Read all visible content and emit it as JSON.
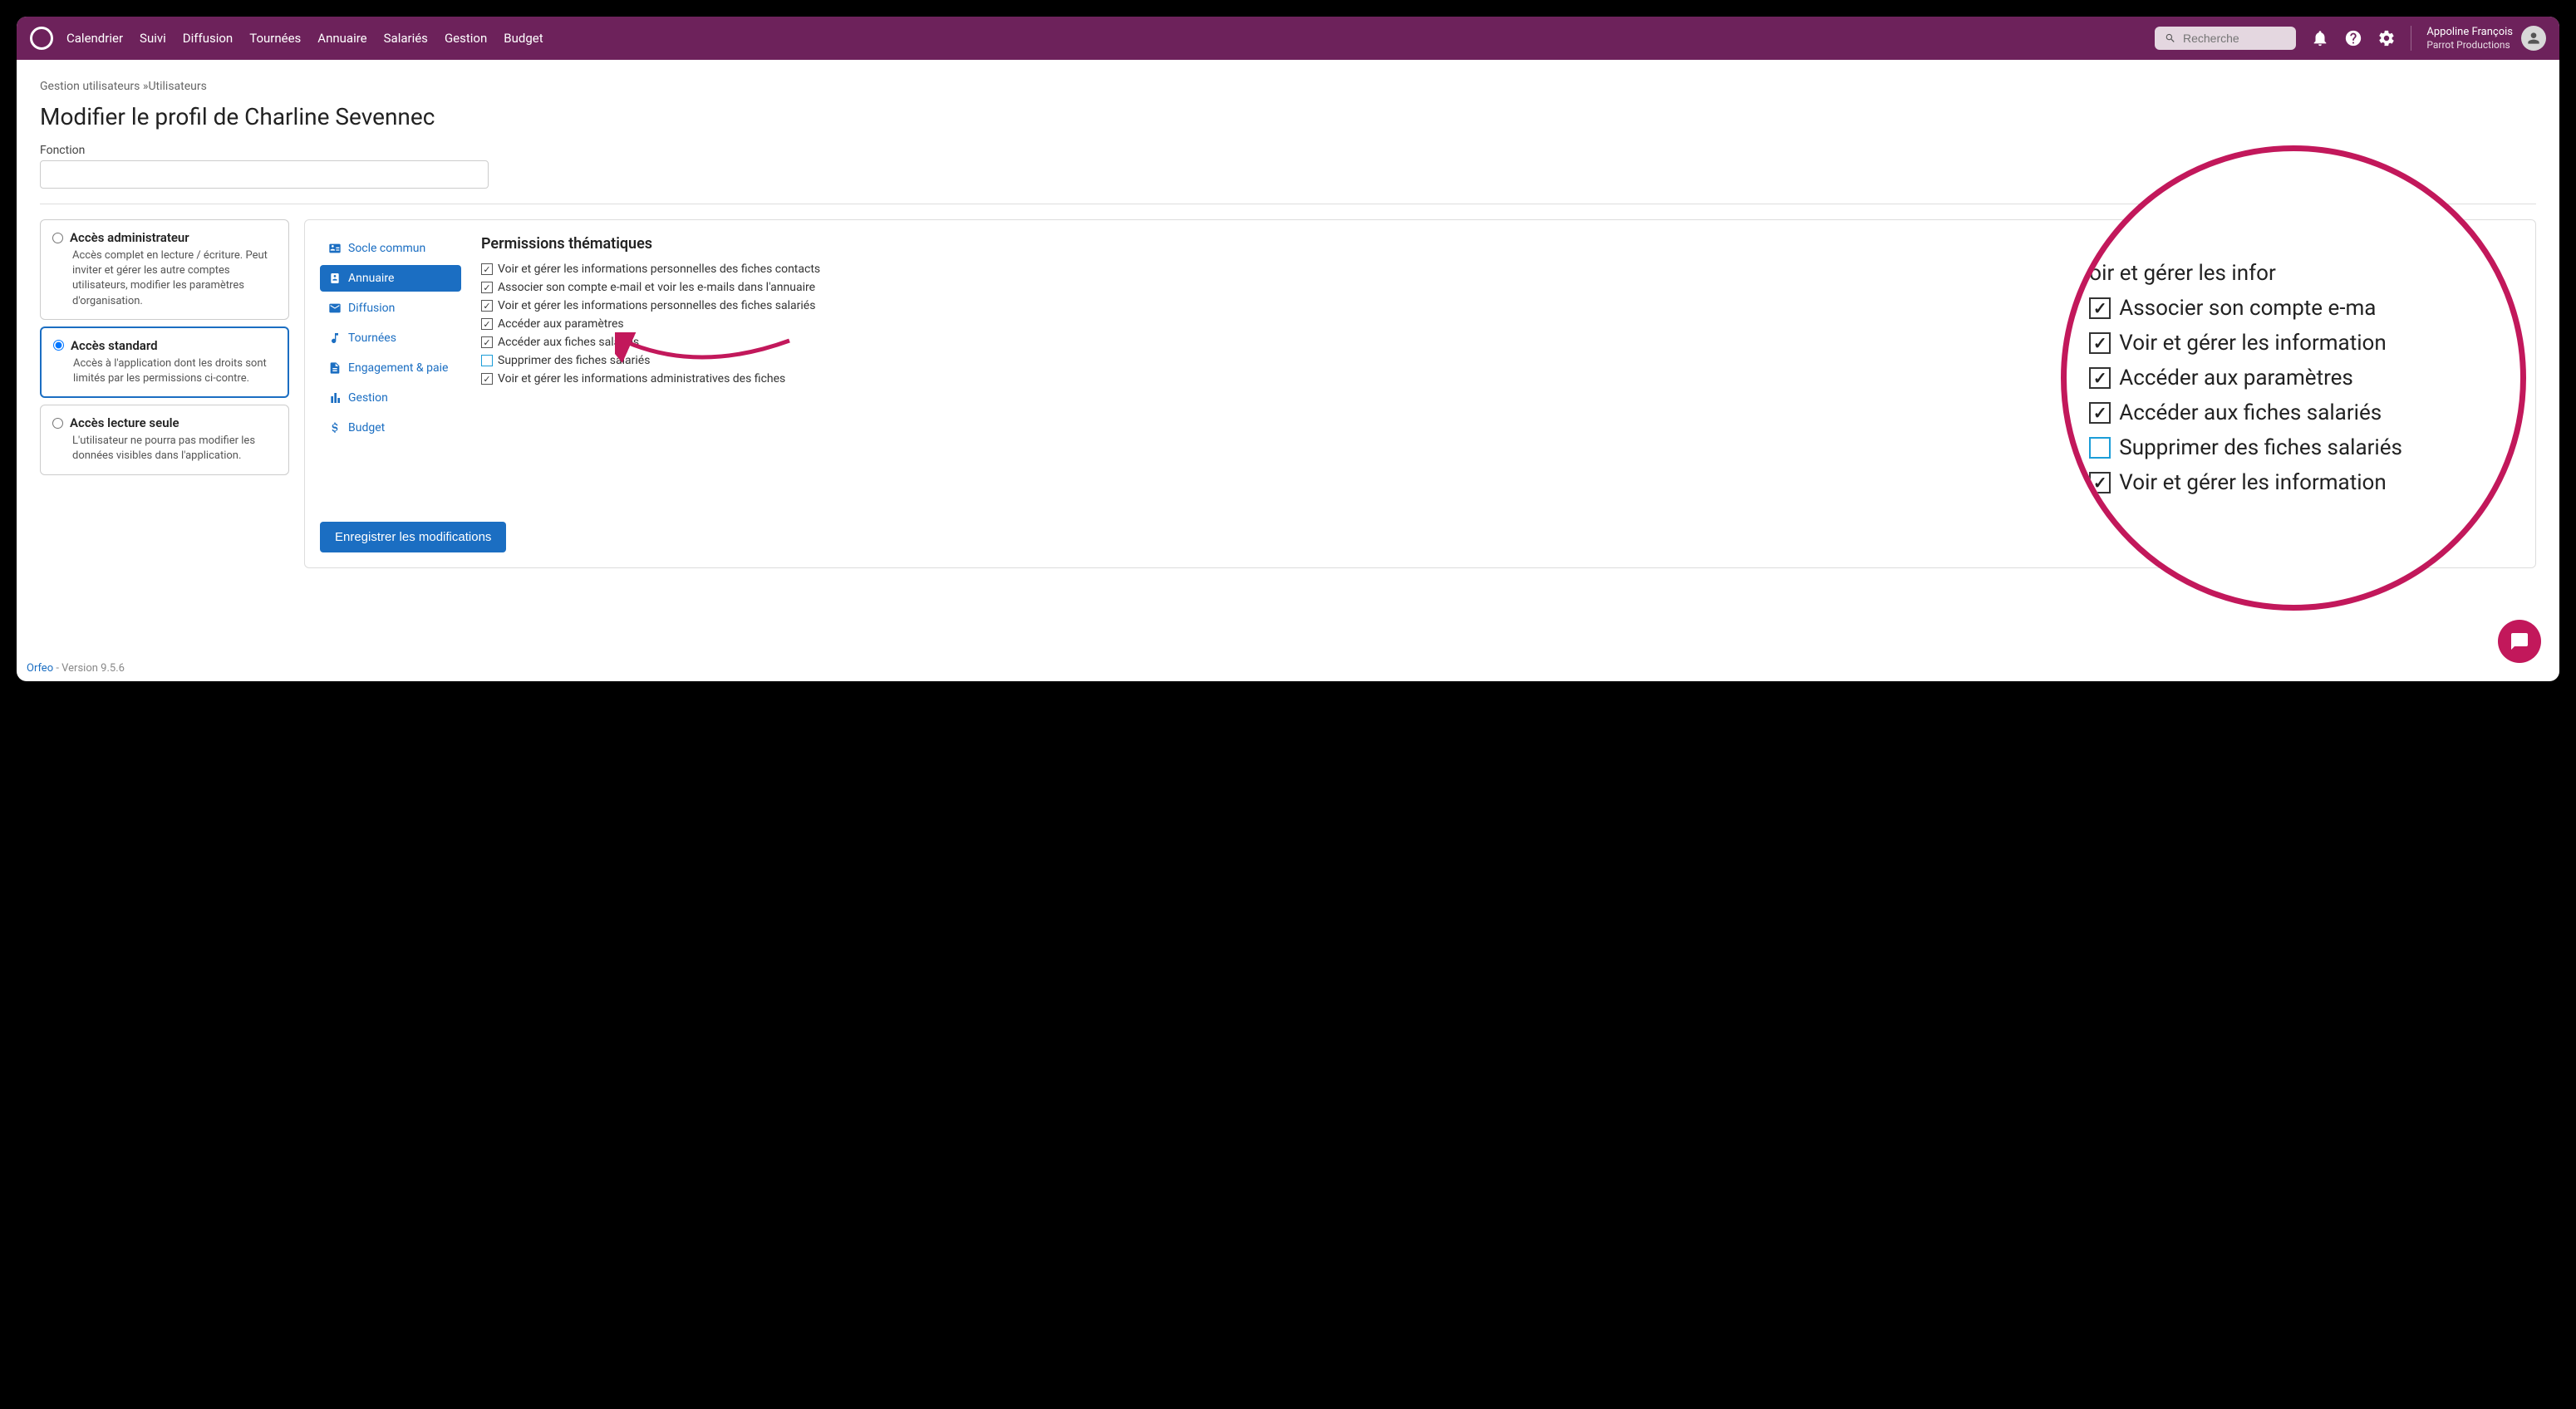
{
  "header": {
    "nav": [
      "Calendrier",
      "Suivi",
      "Diffusion",
      "Tournées",
      "Annuaire",
      "Salariés",
      "Gestion",
      "Budget"
    ],
    "search_placeholder": "Recherche",
    "user_name": "Appoline François",
    "org_name": "Parrot Productions"
  },
  "breadcrumb": {
    "parent": "Gestion utilisateurs",
    "current": "Utilisateurs",
    "separator": " »"
  },
  "page_title": "Modifier le profil de Charline Sevennec",
  "field": {
    "label": "Fonction",
    "value": ""
  },
  "access_levels": [
    {
      "id": "admin",
      "label": "Accès administrateur",
      "desc": "Accès complet en lecture / écriture. Peut inviter et gérer les autre comptes utilisateurs, modifier les paramètres d'organisation.",
      "selected": false
    },
    {
      "id": "standard",
      "label": "Accès standard",
      "desc": "Accès à l'application dont les droits sont limités par les permissions ci-contre.",
      "selected": true
    },
    {
      "id": "readonly",
      "label": "Accès lecture seule",
      "desc": "L'utilisateur ne pourra pas modifier les données visibles dans l'application.",
      "selected": false
    }
  ],
  "perm_tabs": [
    {
      "id": "socle",
      "label": "Socle commun",
      "icon": "id-card-icon"
    },
    {
      "id": "annuaire",
      "label": "Annuaire",
      "icon": "addressbook-icon",
      "active": true
    },
    {
      "id": "diffusion",
      "label": "Diffusion",
      "icon": "envelope-icon"
    },
    {
      "id": "tournees",
      "label": "Tournées",
      "icon": "music-icon"
    },
    {
      "id": "engagement",
      "label": "Engagement & paie",
      "icon": "file-icon"
    },
    {
      "id": "gestion",
      "label": "Gestion",
      "icon": "bar-chart-icon"
    },
    {
      "id": "budget",
      "label": "Budget",
      "icon": "dollar-icon"
    }
  ],
  "permissions": {
    "heading": "Permissions thématiques",
    "items": [
      {
        "label": "Voir et gérer les informations personnelles des fiches contacts",
        "checked": true
      },
      {
        "label": "Associer son compte e-mail et voir les e-mails dans l'annuaire",
        "checked": true
      },
      {
        "label": "Voir et gérer les informations personnelles des fiches salariés",
        "checked": true
      },
      {
        "label": "Accéder aux paramètres",
        "checked": true
      },
      {
        "label": "Accéder aux fiches salariés",
        "checked": true
      },
      {
        "label": "Supprimer des fiches salariés",
        "checked": false,
        "blue": true
      },
      {
        "label": "Voir et gérer les informations administratives des fiches",
        "checked": true
      }
    ]
  },
  "zoom": {
    "lines": [
      {
        "text": "oir et gérer les infor",
        "checked": true,
        "partial": true
      },
      {
        "text": "Associer son compte e-ma",
        "checked": true
      },
      {
        "text": "Voir et gérer les information",
        "checked": true
      },
      {
        "text": "Accéder aux paramètres",
        "checked": true
      },
      {
        "text": "Accéder aux fiches salariés",
        "checked": true
      },
      {
        "text": "Supprimer des fiches salariés",
        "checked": false,
        "blue": true
      },
      {
        "text": "Voir et gérer les information",
        "checked": true
      }
    ]
  },
  "save_button": "Enregistrer les modifications",
  "footer": {
    "app": "Orfeo",
    "version": " - Version 9.5.6"
  }
}
